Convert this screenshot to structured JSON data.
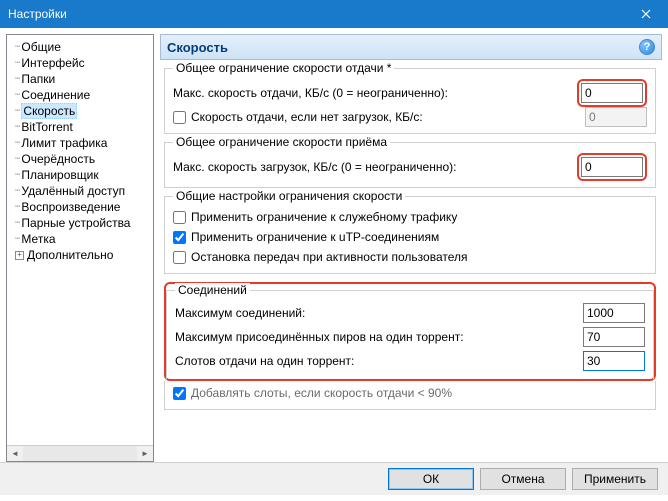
{
  "window": {
    "title": "Настройки"
  },
  "tree": {
    "items": [
      {
        "label": "Общие"
      },
      {
        "label": "Интерфейс"
      },
      {
        "label": "Папки"
      },
      {
        "label": "Соединение"
      },
      {
        "label": "Скорость",
        "selected": true
      },
      {
        "label": "BitTorrent"
      },
      {
        "label": "Лимит трафика"
      },
      {
        "label": "Очерёдность"
      },
      {
        "label": "Планировщик"
      },
      {
        "label": "Удалённый доступ"
      },
      {
        "label": "Воспроизведение"
      },
      {
        "label": "Парные устройства"
      },
      {
        "label": "Метка"
      },
      {
        "label": "Дополнительно",
        "expandable": true
      }
    ]
  },
  "header": {
    "title": "Скорость"
  },
  "upload": {
    "legend": "Общее ограничение скорости отдачи *",
    "max_label": "Макс. скорость отдачи, КБ/с (0 = неограниченно):",
    "max_value": "0",
    "alt_label": "Скорость отдачи, если нет загрузок, КБ/с:",
    "alt_value": "0"
  },
  "download": {
    "legend": "Общее ограничение скорости приёма",
    "max_label": "Макс. скорость загрузок, КБ/с (0 = неограниченно):",
    "max_value": "0"
  },
  "rate": {
    "legend": "Общие настройки ограничения скорости",
    "c1": "Применить ограничение к служебному трафику",
    "c2": "Применить ограничение к uTP-соединениям",
    "c3": "Остановка передач при активности пользователя"
  },
  "conn": {
    "legend": "Соединений",
    "r1": "Максимум соединений:",
    "v1": "1000",
    "r2": "Максимум присоединённых пиров на один торрент:",
    "v2": "70",
    "r3": "Слотов отдачи на один торрент:",
    "v3": "30",
    "c4": "Добавлять слоты, если скорость отдачи < 90%"
  },
  "footer": {
    "ok": "ОК",
    "cancel": "Отмена",
    "apply": "Применить"
  }
}
